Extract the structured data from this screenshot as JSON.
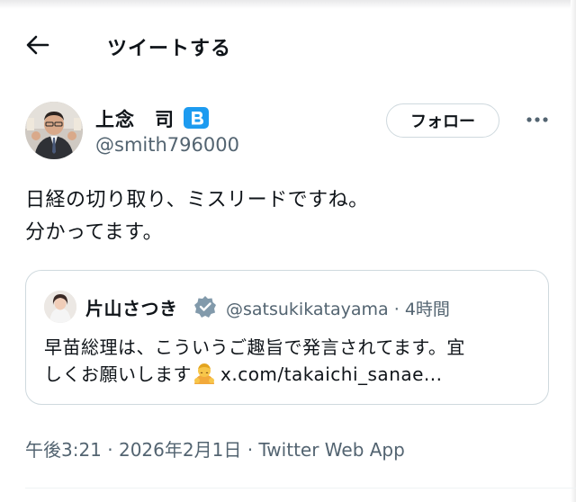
{
  "header": {
    "back_icon": "arrow-left-icon",
    "title": "ツイートする"
  },
  "author": {
    "name": "上念　司",
    "handle": "@smith796000",
    "badge_icon": "verified-badge-icon",
    "badge_color": "#1d9bf0"
  },
  "actions": {
    "follow_label": "フォロー",
    "more_icon": "more-dots-icon"
  },
  "tweet": {
    "lines": [
      "日経の切り取り、ミスリードですね。",
      "分かってます。"
    ]
  },
  "quote": {
    "name": "片山さつき",
    "badge_icon": "gray-verified-badge-icon",
    "handle": "@satsukikatayama",
    "separator": "·",
    "time": "4時間",
    "line1": "早苗総理は、こういうご趣旨で発言されてます。宜",
    "line2_text": "しくお願いします",
    "emoji_icon": "person-bowing-emoji",
    "link": "x.com/takaichi_sanae..."
  },
  "meta": {
    "timestamp": "午後3:21 · 2026年2月1日 · Twitter Web App"
  },
  "colors": {
    "text": "#0f1419",
    "secondary": "#536471",
    "border": "#cfd9de",
    "accent": "#1d9bf0"
  }
}
